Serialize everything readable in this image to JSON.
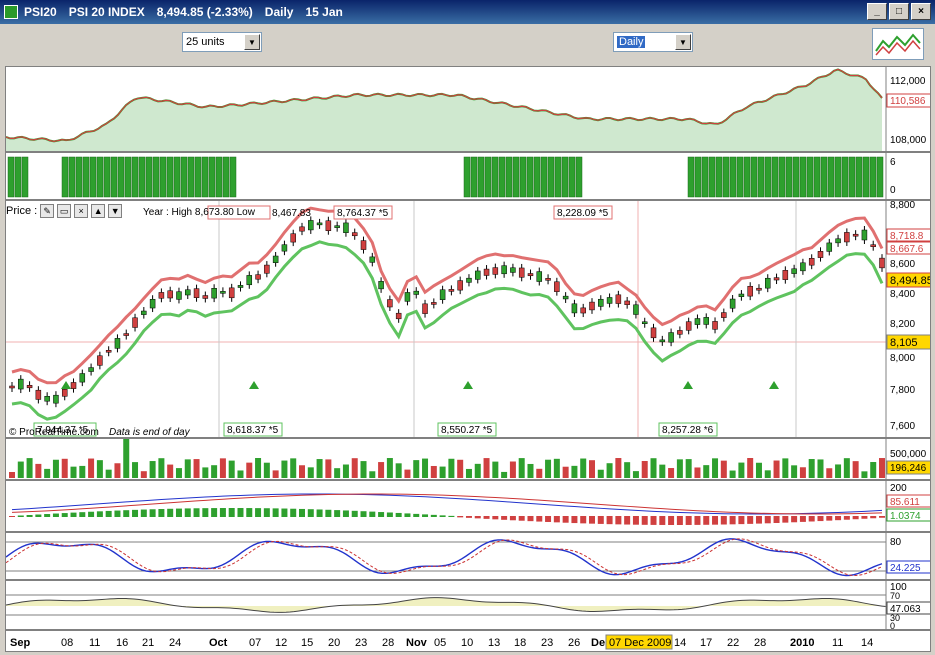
{
  "window": {
    "symbol": "PSI20",
    "name": "PSI 20 INDEX",
    "quote": "8,494.85 (-2.33%)",
    "period": "Daily",
    "date": "15 Jan"
  },
  "toolbar": {
    "units_value": "25 units",
    "period_value": "Daily"
  },
  "price_panel": {
    "label": "Price :",
    "year_text": "Year : High 8,673.80 Low",
    "watermark": "© ProRealTime.com",
    "eod_note": "Data is end of day",
    "current_price": "8,494.85",
    "value_box_1": "8,718.8",
    "value_box_2": "8,667.6",
    "crosshair_price": "8,105",
    "boxes_top": [
      "8,467.83",
      "8,764.37 *5",
      "8,228.09 *5"
    ],
    "boxes_bottom": [
      "7,944.37 *5",
      "8,618.37 *5",
      "8,550.27 *5",
      "8,257.28 *6"
    ],
    "axis_ticks": [
      "8,800",
      "8,600",
      "8,400",
      "8,200",
      "8,000",
      "7,800",
      "7,600"
    ]
  },
  "top_panel": {
    "axis_ticks": [
      "112,000",
      "110,586",
      "108,000"
    ],
    "current": "110,586"
  },
  "bar_panel": {
    "axis_ticks": [
      "6",
      "0"
    ]
  },
  "volume_panel": {
    "axis_ticks": [
      "500,000",
      "196,246"
    ],
    "current": "196,246"
  },
  "macd_panel": {
    "axis_ticks": [
      "200",
      "85.611",
      "1.0374"
    ],
    "v1": "85.611",
    "v2": "1.0374"
  },
  "stoch_panel": {
    "axis_ticks": [
      "80",
      "24.225"
    ],
    "current": "24.225"
  },
  "rsi_panel": {
    "axis_ticks": [
      "100",
      "70",
      "47.063",
      "30",
      "0"
    ],
    "current": "47.063"
  },
  "x_axis": {
    "labels": [
      "Sep",
      "08",
      "11",
      "16",
      "21",
      "24",
      "Oct",
      "07",
      "12",
      "15",
      "20",
      "23",
      "28",
      "Nov",
      "05",
      "10",
      "13",
      "18",
      "23",
      "26",
      "De",
      "14",
      "17",
      "22",
      "28",
      "2010",
      "11",
      "14"
    ],
    "crosshair_date": "07 Dec 2009"
  },
  "colors": {
    "bull": "#2ea02e",
    "bear": "#d04040",
    "support_line": "#5fc35f",
    "resistance_line": "#e07070",
    "accent": "#316ac5"
  }
}
